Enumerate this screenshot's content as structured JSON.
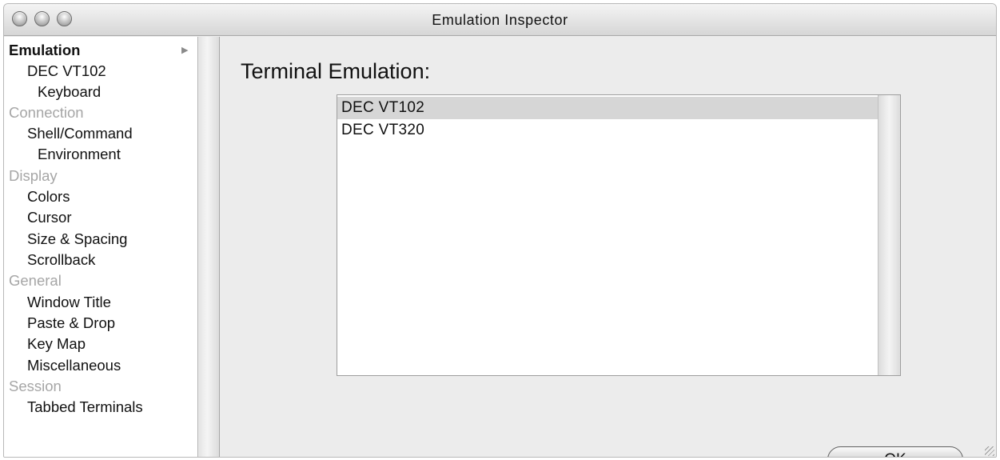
{
  "window": {
    "title": "Emulation Inspector",
    "controls": [
      "close-button",
      "minimize-button",
      "zoom-button"
    ]
  },
  "sidebar": {
    "items": [
      {
        "label": "Emulation",
        "kind": "section-selected"
      },
      {
        "label": "DEC VT102",
        "kind": "item"
      },
      {
        "label": "Keyboard",
        "kind": "subitem"
      },
      {
        "label": "Connection",
        "kind": "section"
      },
      {
        "label": "Shell/Command",
        "kind": "item"
      },
      {
        "label": "Environment",
        "kind": "subitem"
      },
      {
        "label": "Display",
        "kind": "section"
      },
      {
        "label": "Colors",
        "kind": "item"
      },
      {
        "label": "Cursor",
        "kind": "item"
      },
      {
        "label": "Size & Spacing",
        "kind": "item"
      },
      {
        "label": "Scrollback",
        "kind": "item"
      },
      {
        "label": "General",
        "kind": "section"
      },
      {
        "label": "Window Title",
        "kind": "item"
      },
      {
        "label": "Paste & Drop",
        "kind": "item"
      },
      {
        "label": "Key Map",
        "kind": "item"
      },
      {
        "label": "Miscellaneous",
        "kind": "item"
      },
      {
        "label": "Session",
        "kind": "section"
      },
      {
        "label": "Tabbed Terminals",
        "kind": "item"
      }
    ],
    "arrow_icon": "disclosure-triangle-right-icon"
  },
  "main": {
    "heading": "Terminal Emulation:",
    "emulation_list": {
      "items": [
        "DEC VT102",
        "DEC VT320"
      ],
      "selected": "DEC VT102"
    },
    "ok_label": "OK"
  },
  "colors": {
    "selection": "#d6d6d6",
    "section_header": "#a6a6a6",
    "window_background": "#ececec"
  }
}
